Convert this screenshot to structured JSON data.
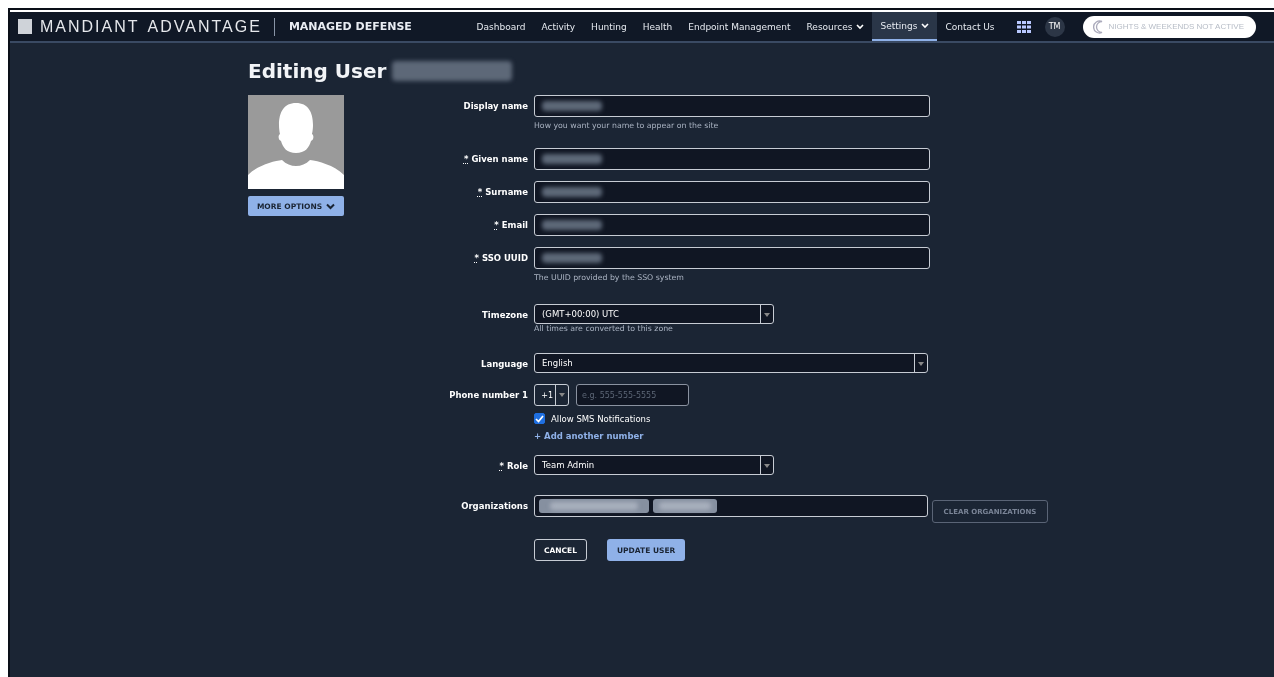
{
  "header": {
    "logo_word": "MANDIANT",
    "logo_word_2": "ADVANTAGE",
    "product": "MANAGED DEFENSE",
    "nav": [
      {
        "label": "Dashboard",
        "selected": false,
        "dropdown": false
      },
      {
        "label": "Activity",
        "selected": false,
        "dropdown": false
      },
      {
        "label": "Hunting",
        "selected": false,
        "dropdown": false
      },
      {
        "label": "Health",
        "selected": false,
        "dropdown": false
      },
      {
        "label": "Endpoint Management",
        "selected": false,
        "dropdown": false
      },
      {
        "label": "Resources",
        "selected": false,
        "dropdown": true
      },
      {
        "label": "Settings",
        "selected": true,
        "dropdown": true
      },
      {
        "label": "Contact Us",
        "selected": false,
        "dropdown": false
      }
    ],
    "avatar": "TM",
    "toggle": {
      "label": "NIGHTS & WEEKENDS NOT ACTIVE",
      "on": false
    }
  },
  "title": "Editing User",
  "title_redacted": true,
  "more_options": "MORE OPTIONS",
  "fields": [
    {
      "kind": "text",
      "label": "Display name",
      "redacted": true,
      "hint": "How you want your name to appear on the site"
    },
    {
      "kind": "text",
      "label": "Given name",
      "required_mark": "*",
      "redacted": true
    },
    {
      "kind": "text",
      "label": "Surname",
      "required_mark": "*",
      "redacted": true
    },
    {
      "kind": "text",
      "label": "Email",
      "required_mark": "*",
      "redacted": true
    },
    {
      "kind": "text",
      "label": "SSO UUID",
      "required_mark": "*",
      "redacted": true,
      "hint": "The UUID provided by the SSO system"
    },
    {
      "kind": "select",
      "label": "Timezone",
      "value": "(GMT+00:00) UTC",
      "hint": "All times are converted to this zone"
    },
    {
      "kind": "select",
      "label": "Language",
      "value": "English"
    },
    {
      "kind": "phone",
      "label": "Phone number 1",
      "code": "+1",
      "placeholder": "e.g. 555-555-5555",
      "sms": {
        "label": "Allow SMS Notifications",
        "checked": true
      },
      "add_link": "+ Add another number"
    },
    {
      "kind": "select",
      "label": "Role",
      "required_mark": "*",
      "value": "Team Admin"
    },
    {
      "kind": "tags",
      "label": "Organizations",
      "tags": [
        {
          "redacted": true
        },
        {
          "redacted": true
        }
      ],
      "clear": {
        "label": "CLEAR ORGANIZATIONS",
        "disabled": true
      }
    }
  ],
  "buttons": [
    {
      "label": "CANCEL",
      "kind": "secondary"
    },
    {
      "label": "UPDATE USER",
      "kind": "primary"
    }
  ]
}
